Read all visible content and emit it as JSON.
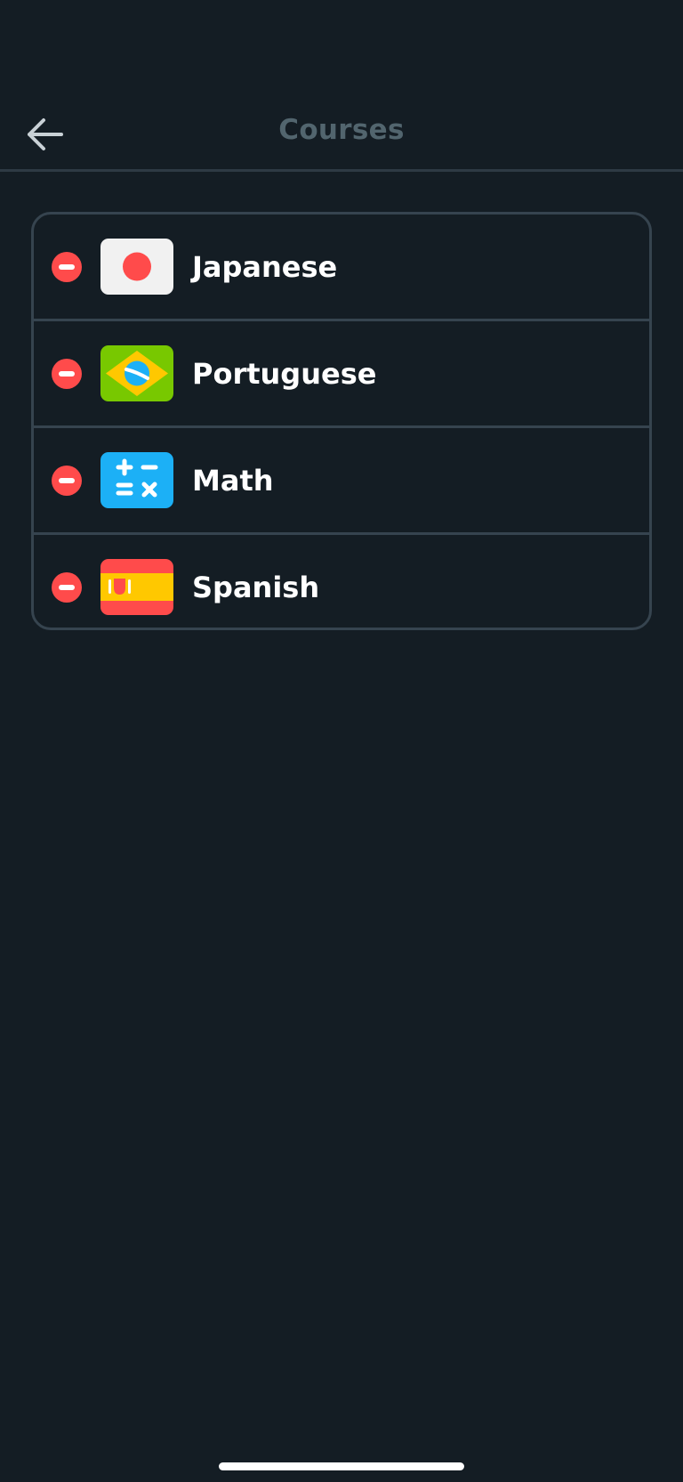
{
  "header": {
    "title": "Courses"
  },
  "icons": {
    "back": "arrow-left-icon",
    "remove": "minus-circle-icon"
  },
  "colors": {
    "background": "#141d24",
    "divider": "#36444f",
    "title": "#52656e",
    "remove": "#ff4b4b"
  },
  "courses": [
    {
      "name": "Japanese",
      "icon": "japan-flag-icon"
    },
    {
      "name": "Portuguese",
      "icon": "brazil-flag-icon"
    },
    {
      "name": "Math",
      "icon": "math-calculator-icon"
    },
    {
      "name": "Spanish",
      "icon": "spain-flag-icon"
    }
  ]
}
